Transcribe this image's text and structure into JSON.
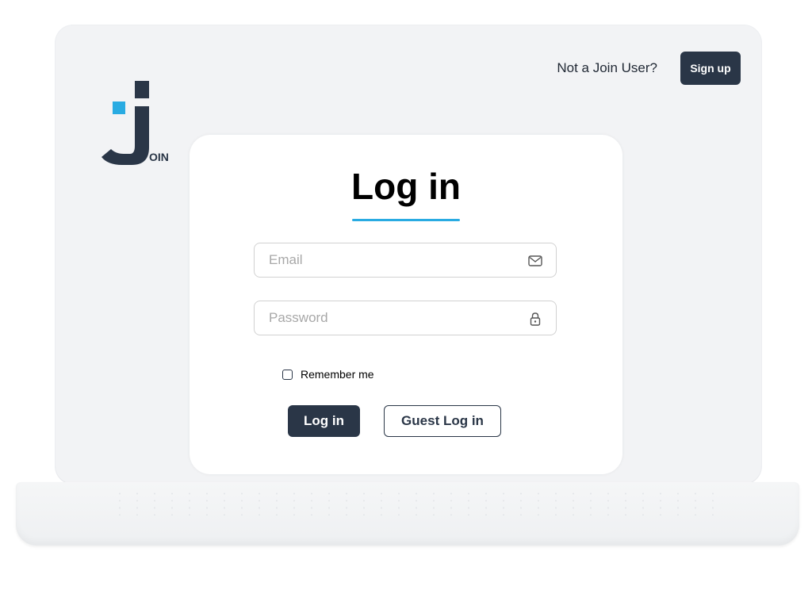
{
  "header": {
    "prompt_text": "Not a Join User?",
    "signup_label": "Sign up"
  },
  "logo": {
    "text": "OIN",
    "icon": "join-logo-icon",
    "brand_color": "#2a3647",
    "accent_color": "#29abe2"
  },
  "login": {
    "title": "Log in",
    "email": {
      "value": "",
      "placeholder": "Email",
      "icon": "mail-icon"
    },
    "password": {
      "value": "",
      "placeholder": "Password",
      "icon": "lock-icon"
    },
    "remember_label": "Remember me",
    "remember_checked": false,
    "login_label": "Log in",
    "guest_label": "Guest Log in"
  }
}
